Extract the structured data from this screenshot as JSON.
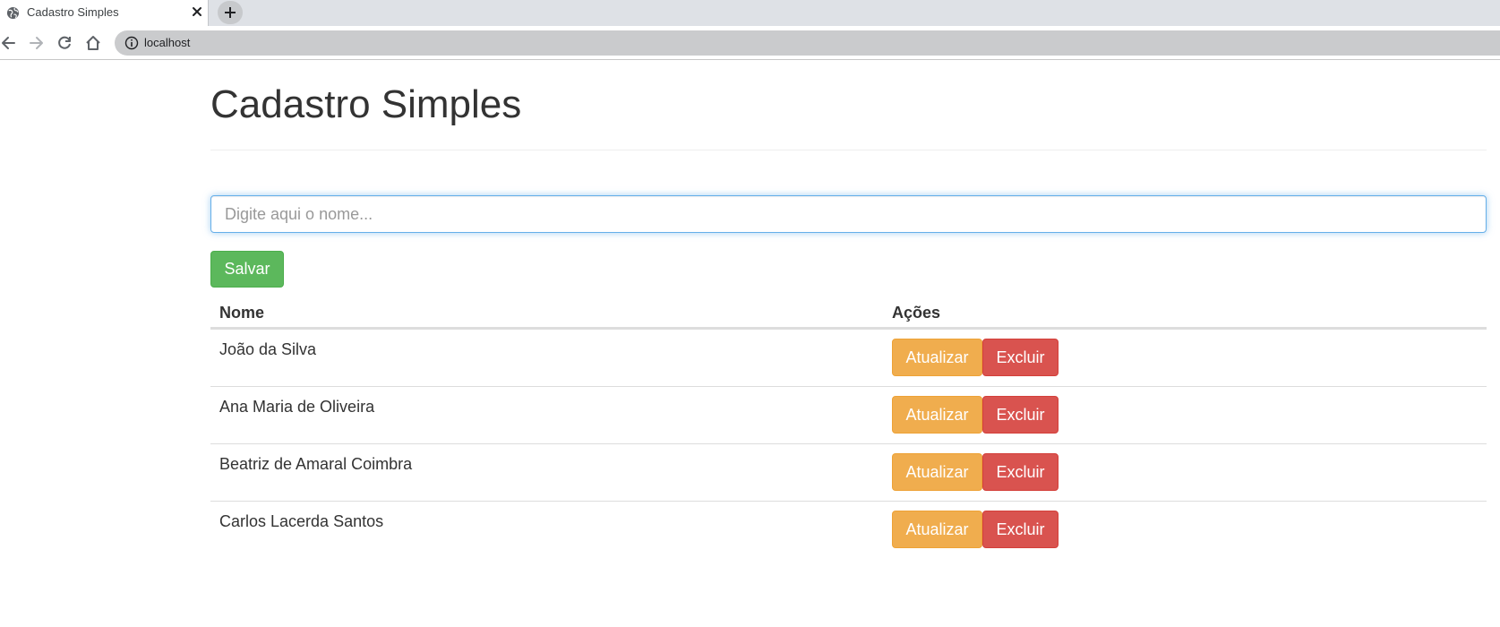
{
  "browser": {
    "tab_title": "Cadastro Simples",
    "url": "localhost",
    "icons": {
      "favicon": "globe-icon",
      "close": "close-icon",
      "new_tab": "plus-icon",
      "back": "arrow-left-icon",
      "forward": "arrow-right-icon",
      "reload": "reload-icon",
      "home": "home-icon",
      "site_info": "info-icon"
    }
  },
  "page": {
    "title": "Cadastro Simples",
    "input": {
      "placeholder": "Digite aqui o nome...",
      "value": ""
    },
    "save_label": "Salvar"
  },
  "table": {
    "headers": {
      "name": "Nome",
      "actions": "Ações"
    },
    "rows": [
      {
        "name": "João da Silva",
        "update": "Atualizar",
        "delete": "Excluir"
      },
      {
        "name": "Ana Maria de Oliveira",
        "update": "Atualizar",
        "delete": "Excluir"
      },
      {
        "name": "Beatriz de Amaral Coimbra",
        "update": "Atualizar",
        "delete": "Excluir"
      },
      {
        "name": "Carlos Lacerda Santos",
        "update": "Atualizar",
        "delete": "Excluir"
      }
    ]
  },
  "colors": {
    "success": "#5cb85c",
    "warning": "#f0ad4e",
    "danger": "#d9534f",
    "focus": "#66afe9"
  }
}
